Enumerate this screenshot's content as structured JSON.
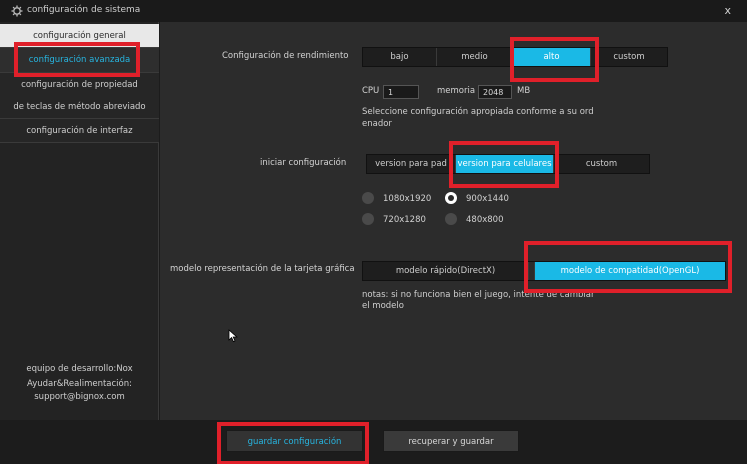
{
  "window": {
    "title": "configuración de sistema",
    "close_glyph": "x",
    "icon": "gear-icon"
  },
  "sidebar": {
    "items": [
      {
        "label": "configuración general"
      },
      {
        "label": "configuración avanzada",
        "active": true
      },
      {
        "label": "configuración de propiedad"
      },
      {
        "label": "de teclas de método abreviado"
      },
      {
        "label": "configuración de interfaz"
      }
    ],
    "footer": {
      "team": "equipo de desarrollo:Nox",
      "help": "Ayudar&Realimentación:",
      "email": "support@bignox.com"
    }
  },
  "performance": {
    "label": "Configuración de rendimiento",
    "options": [
      "bajo",
      "medio",
      "alto",
      "custom"
    ],
    "selected": "alto",
    "cpu_label": "CPU",
    "cpu_value": "1",
    "memory_label": "memoria",
    "memory_value": "2048",
    "memory_unit": "MB",
    "hint_line1": "Seleccione configuración apropiada conforme a su ord",
    "hint_line2": "enador"
  },
  "startup": {
    "label": "iniciar configuración",
    "options": [
      "version para pad",
      "version para celulares",
      "custom"
    ],
    "selected": "version para celulares",
    "resolutions": [
      {
        "label": "1080x1920",
        "selected": false
      },
      {
        "label": "900x1440",
        "selected": true
      },
      {
        "label": "720x1280",
        "selected": false
      },
      {
        "label": "480x800",
        "selected": false
      }
    ]
  },
  "graphics": {
    "label": "modelo representación de la tarjeta gráfica",
    "options": [
      "modelo rápido(DirectX)",
      "modelo de compatidad(OpenGL)"
    ],
    "selected": "modelo de compatidad(OpenGL)",
    "note_line1": "notas: si no funciona bien el juego, intente de cambiar",
    "note_line2": "el modelo"
  },
  "footer_buttons": {
    "save": "guardar configuración",
    "restore": "recuperar y guardar"
  },
  "colors": {
    "accent": "#1ab9e6",
    "highlight": "#e0202a",
    "panel": "#2c2c2c",
    "sidebar": "#232323"
  }
}
